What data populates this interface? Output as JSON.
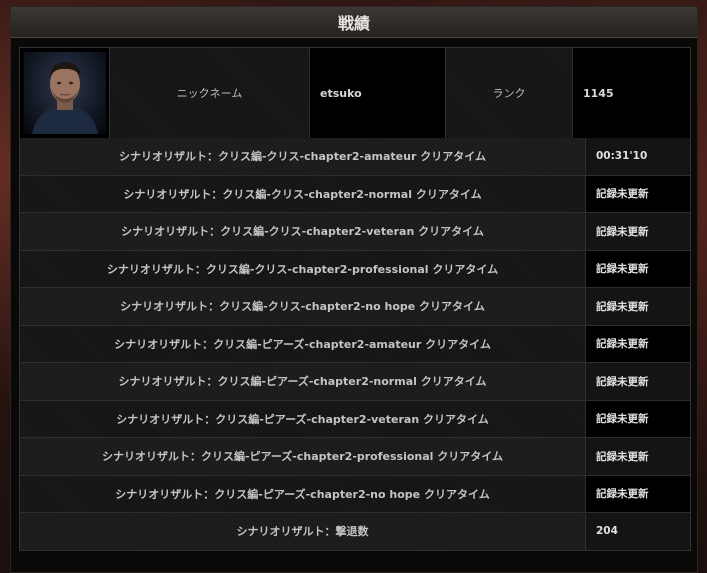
{
  "header": {
    "title": "戦績"
  },
  "profile": {
    "nickname_label": "ニックネーム",
    "nickname_value": "etsuko",
    "rank_label": "ランク",
    "rank_value": "1145"
  },
  "records": [
    {
      "label": "シナリオリザルト：クリス編-クリス-chapter2-amateur クリアタイム",
      "value": "00:31'10"
    },
    {
      "label": "シナリオリザルト：クリス編-クリス-chapter2-normal クリアタイム",
      "value": "記録未更新"
    },
    {
      "label": "シナリオリザルト：クリス編-クリス-chapter2-veteran クリアタイム",
      "value": "記録未更新"
    },
    {
      "label": "シナリオリザルト：クリス編-クリス-chapter2-professional クリアタイム",
      "value": "記録未更新"
    },
    {
      "label": "シナリオリザルト：クリス編-クリス-chapter2-no hope クリアタイム",
      "value": "記録未更新"
    },
    {
      "label": "シナリオリザルト：クリス編-ピアーズ-chapter2-amateur クリアタイム",
      "value": "記録未更新"
    },
    {
      "label": "シナリオリザルト：クリス編-ピアーズ-chapter2-normal クリアタイム",
      "value": "記録未更新"
    },
    {
      "label": "シナリオリザルト：クリス編-ピアーズ-chapter2-veteran クリアタイム",
      "value": "記録未更新"
    },
    {
      "label": "シナリオリザルト：クリス編-ピアーズ-chapter2-professional クリアタイム",
      "value": "記録未更新"
    },
    {
      "label": "シナリオリザルト：クリス編-ピアーズ-chapter2-no hope クリアタイム",
      "value": "記録未更新"
    },
    {
      "label": "シナリオリザルト：撃退数",
      "value": "204"
    }
  ]
}
